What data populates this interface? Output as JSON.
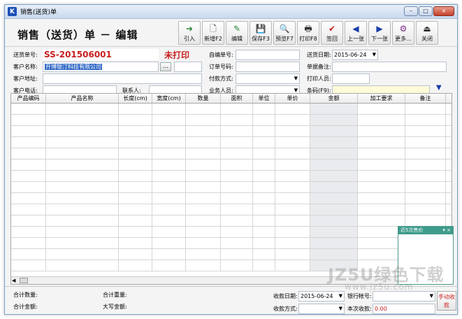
{
  "window": {
    "title": "销售(送货)单",
    "icon_letter": "K",
    "controls": [
      "–",
      "□",
      "×"
    ]
  },
  "toolbar": {
    "form_title": "销售（送货）单 － 编辑",
    "buttons": [
      {
        "label": "引入",
        "icon": "import-arrow-icon",
        "glyph": "➜",
        "color": "green"
      },
      {
        "label": "新增F2",
        "icon": "new-doc-icon",
        "glyph": "🗋",
        "color": ""
      },
      {
        "label": "编辑",
        "icon": "edit-icon",
        "glyph": "✎",
        "color": "green"
      },
      {
        "label": "保存F3",
        "icon": "save-icon",
        "glyph": "💾",
        "color": ""
      },
      {
        "label": "预览F7",
        "icon": "preview-icon",
        "glyph": "🔍",
        "color": ""
      },
      {
        "label": "打印F8",
        "icon": "print-icon",
        "glyph": "🖶",
        "color": ""
      },
      {
        "label": "签回",
        "icon": "check-icon",
        "glyph": "✔",
        "color": "red"
      },
      {
        "label": "上一张",
        "icon": "prev-icon",
        "glyph": "◀",
        "color": "blue"
      },
      {
        "label": "下一张",
        "icon": "next-icon",
        "glyph": "▶",
        "color": "blue"
      },
      {
        "label": "更多...",
        "icon": "more-icon",
        "glyph": "⚙",
        "color": "purple"
      },
      {
        "label": "关闭",
        "icon": "close-door-icon",
        "glyph": "⏏",
        "color": ""
      }
    ]
  },
  "header": {
    "doc_no_label": "送货单号:",
    "doc_no": "SS-201506001",
    "print_status": "未打印",
    "custom_no_label": "自编单号:",
    "custom_no": "",
    "delivery_date_label": "送货日期:",
    "delivery_date": "2015-06-24",
    "customer_name_label": "客户名称:",
    "customer_name": "开博银汀科技有限公司",
    "order_no_label": "订单号码:",
    "order_no": "",
    "doc_remark_label": "单据备注:",
    "doc_remark": "",
    "customer_address_label": "客户地址:",
    "customer_address": "",
    "payment_method_label": "付款方式:",
    "payment_method": "",
    "printer_label": "打印人员:",
    "printer": "",
    "customer_phone_label": "客户电话:",
    "customer_phone": "",
    "contact_label": "联系人:",
    "contact": "",
    "salesperson_label": "业务人员:",
    "salesperson": "",
    "barcode_label": "条码(F9):",
    "barcode": ""
  },
  "grid": {
    "columns": [
      "产品编码",
      "产品名称",
      "长度(cm)",
      "宽度(cm)",
      "数量",
      "面积",
      "单位",
      "单价",
      "金额",
      "加工要求",
      "备注"
    ],
    "rows": 15
  },
  "price_panel": {
    "title": "近5次售价",
    "controls": "▾ ×"
  },
  "footer": {
    "total_qty_label": "合计数量:",
    "total_weight_label": "合计重量:",
    "total_amount_label": "合计金额:",
    "amount_upper_label": "大写金额:",
    "receipt_date_label": "收款日期:",
    "receipt_date": "2015-06-24",
    "bank_account_label": "银行帐号:",
    "bank_account": "",
    "receipt_method_label": "收款方式:",
    "receipt_method": "",
    "this_receipt_label": "本次收款:",
    "this_receipt": "0.00",
    "manual_button": "手动收款"
  },
  "watermark": {
    "line1": "JZ5U绿色下载",
    "line2": "www.jz5u.com"
  },
  "colors": {
    "doc_no": "#c81e1e",
    "title_bar": "#c9d9ee",
    "selection": "#3169c6",
    "barcode_bg": "#fffbd8"
  }
}
